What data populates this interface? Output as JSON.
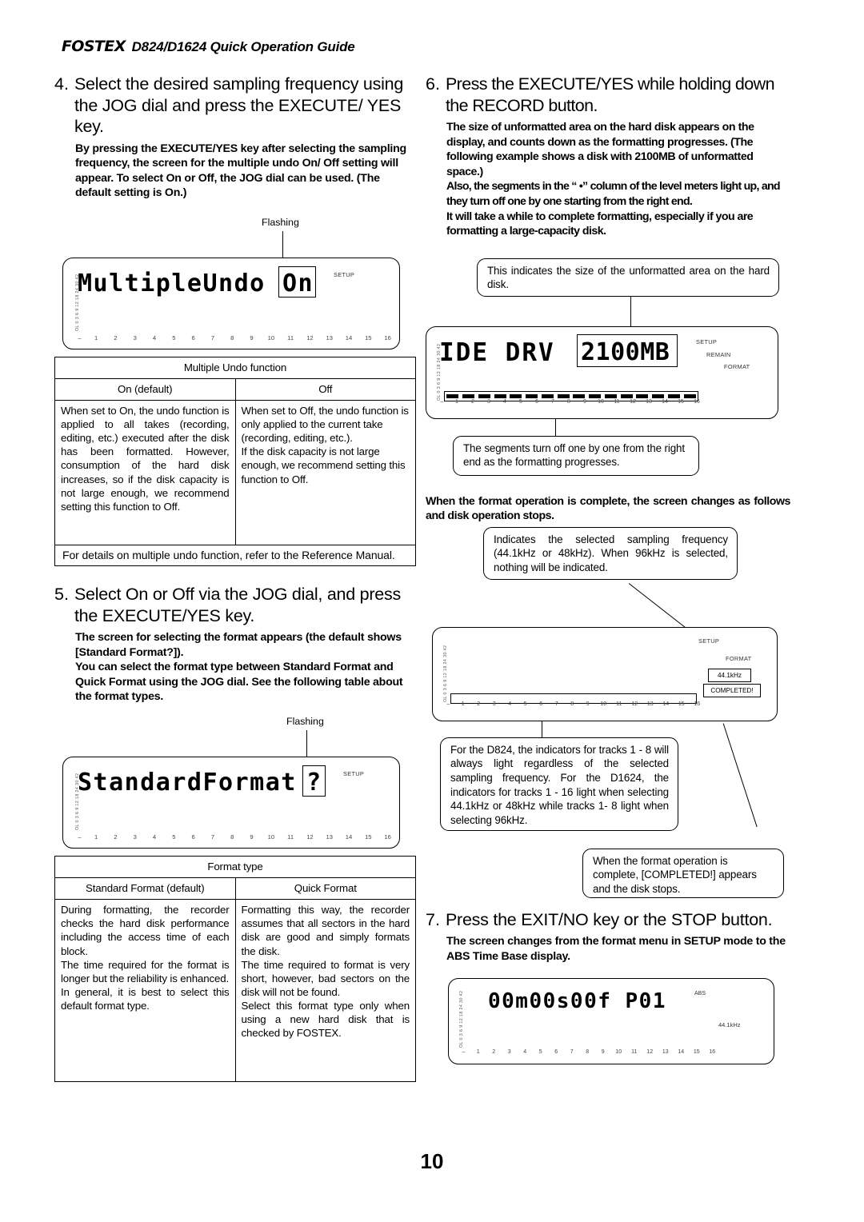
{
  "header": {
    "brand": "FOSTEX",
    "title": "D824/D1624 Quick Operation Guide"
  },
  "page_number": "10",
  "steps": {
    "step4": {
      "number": "4.",
      "title": "Select the desired sampling frequency using the JOG dial and press the EXECUTE/ YES key.",
      "body": "By pressing the EXECUTE/YES key after selecting the sampling frequency, the screen for the multiple undo On/ Off setting will appear. To select On or Off, the JOG dial can be used. (The default setting is On.)"
    },
    "step5": {
      "number": "5.",
      "title": "Select On or Off via the JOG dial, and press the EXECUTE/YES key.",
      "body_1": "The screen for selecting the format appears (the default shows [Standard Format?]).",
      "body_2": "You can select the format type between Standard Format and Quick Format using the JOG dial.  See the following table about the format types."
    },
    "step6": {
      "number": "6.",
      "title": "Press the EXECUTE/YES while holding down the RECORD button.",
      "body_1": "The size of unformatted area on the hard disk appears on the display, and counts down as the formatting progresses. (The following example shows a disk with 2100MB of unformatted space.)",
      "body_2": "Also, the segments in the “     •” column of the level meters light up, and they turn off one by one starting from the right end.",
      "body_3": "It will take a while to complete formatting, especially if you are formatting a large-capacity disk.",
      "body_4": "When the format operation is complete, the screen changes as follows and disk operation stops."
    },
    "step7": {
      "number": "7.",
      "title": "Press the EXIT/NO key or the STOP button.",
      "body": "The screen changes from the format menu in SETUP mode to the ABS Time Base display."
    }
  },
  "lcd": {
    "scale_labels": "OL 0 3 6 9 12 18 24 30 42",
    "track_dash": "–",
    "track_numbers": [
      "1",
      "2",
      "3",
      "4",
      "5",
      "6",
      "7",
      "8",
      "9",
      "10",
      "11",
      "12",
      "13",
      "14",
      "15",
      "16"
    ],
    "undo_screen": {
      "text": "MultipleUndo",
      "boxed_value": "On",
      "indicator_setup": "SETUP",
      "flashing_label": "Flashing"
    },
    "format_screen": {
      "text": "StandardFormat",
      "boxed_value": "?",
      "indicator_setup": "SETUP",
      "flashing_label": "Flashing"
    },
    "ide_screen": {
      "text": "IDE DRV",
      "boxed_value": "2100MB",
      "indicator_setup": "SETUP",
      "indicator_remain": "REMAIN",
      "indicator_format": "FORMAT"
    },
    "completed_screen": {
      "indicator_setup": "SETUP",
      "indicator_format": "FORMAT",
      "boxed_rate": "44.1kHz",
      "boxed_completed": "COMPLETED!"
    },
    "abs_screen": {
      "text": "00m00s00f P01",
      "indicator_abs": "ABS",
      "indicator_rate": "44.1kHz"
    }
  },
  "tables": {
    "multiple_undo": {
      "title": "Multiple Undo function",
      "col_headers": [
        "On (default)",
        "Off"
      ],
      "cells": [
        "When set to On, the undo function is applied to all takes (recording, editing, etc.) executed after the disk has been formatted. However, consumption of the hard disk increases, so if the disk capacity is not large enough, we recommend setting this function to Off.",
        "When set to Off, the undo function is only applied to the current take (recording, editing, etc.).\nIf the disk capacity is not large enough, we recommend setting this function to Off."
      ],
      "footnote": "For details on multiple undo function, refer to the Reference Manual."
    },
    "format_type": {
      "title": "Format type",
      "col_headers": [
        "Standard Format (default)",
        "Quick Format"
      ],
      "cells": [
        "During formatting, the recorder checks the hard disk performance including the access time of each block.\nThe time required for the format is longer but the reliability is enhanced.\nIn general, it is best to select this default format type.",
        "Formatting this way, the recorder assumes that all sectors in the hard disk are good and simply formats the disk.\nThe time required to format is very short, however, bad sectors on the disk will not be found.\nSelect this format type only when using a new hard disk that is checked by FOSTEX."
      ]
    }
  },
  "balloons": {
    "unformatted_size": "This indicates the size of the unformatted area on the hard disk.",
    "segments_off": "The segments turn off one by one from the right end as the formatting progresses.",
    "sampling_freq": "Indicates the selected sampling frequency (44.1kHz or 48kHz).  When 96kHz is selected, nothing will be indicated.",
    "track_indicators": "For the D824, the indicators for tracks 1 - 8 will always light regardless of the selected sampling frequency. For the D1624, the indicators for tracks 1 - 16 light when selecting 44.1kHz or 48kHz while tracks 1- 8 light when selecting 96kHz.",
    "completed": "When the format operation is complete, [COMPLETED!] appears and the disk stops."
  }
}
